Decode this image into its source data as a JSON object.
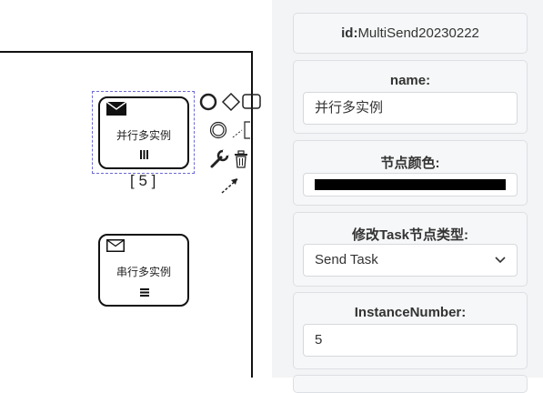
{
  "canvas": {
    "task_parallel": {
      "label": "并行多实例",
      "loop_count": "[ 5 ]"
    },
    "task_serial": {
      "label": "串行多实例"
    }
  },
  "panel": {
    "id_key": "id:",
    "id_value": "MultiSend20230222",
    "name_label": "name:",
    "name_value": "并行多实例",
    "color_label": "节点颜色:",
    "color_value": "#000000",
    "type_label": "修改Task节点类型:",
    "type_value": "Send Task",
    "instance_label": "InstanceNumber:",
    "instance_value": "5"
  },
  "icons": [
    "envelope-icon",
    "parallel-marker-icon",
    "sequential-marker-icon",
    "circle-icon",
    "diamond-icon",
    "rounded-rect-icon",
    "intermediate-event-icon",
    "text-annotation-icon",
    "wrench-icon",
    "trash-icon",
    "connect-arrow-icon",
    "chevron-down-icon"
  ]
}
